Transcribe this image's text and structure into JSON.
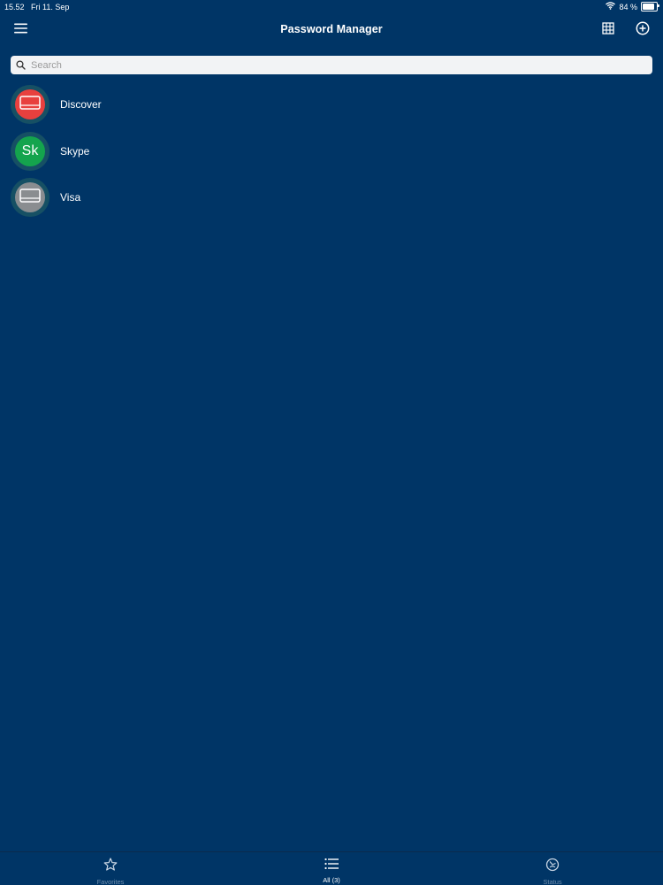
{
  "status_bar": {
    "time": "15.52",
    "date": "Fri 11. Sep",
    "battery_text": "84 %",
    "battery_level": 0.84
  },
  "nav": {
    "title": "Password Manager",
    "icons": [
      "menu-icon",
      "grid-icon",
      "add-circle-icon"
    ]
  },
  "search": {
    "placeholder": "Search",
    "value": ""
  },
  "items": [
    {
      "label": "Discover",
      "icon": "card-icon",
      "avatar_text": "",
      "color": "#e8403e"
    },
    {
      "label": "Skype",
      "icon": "",
      "avatar_text": "Sk",
      "color": "#14a44d"
    },
    {
      "label": "Visa",
      "icon": "card-icon",
      "avatar_text": "",
      "color": "#8a8d90"
    }
  ],
  "tabs": [
    {
      "label": "Favorites",
      "icon": "star-icon",
      "active": false
    },
    {
      "label": "All (3)",
      "icon": "list-icon",
      "active": true
    },
    {
      "label": "Status",
      "icon": "status-icon",
      "active": false
    }
  ],
  "colors": {
    "background": "#003566",
    "search_bg": "#f2f3f5",
    "inactive_tab": "#6f8fae"
  }
}
